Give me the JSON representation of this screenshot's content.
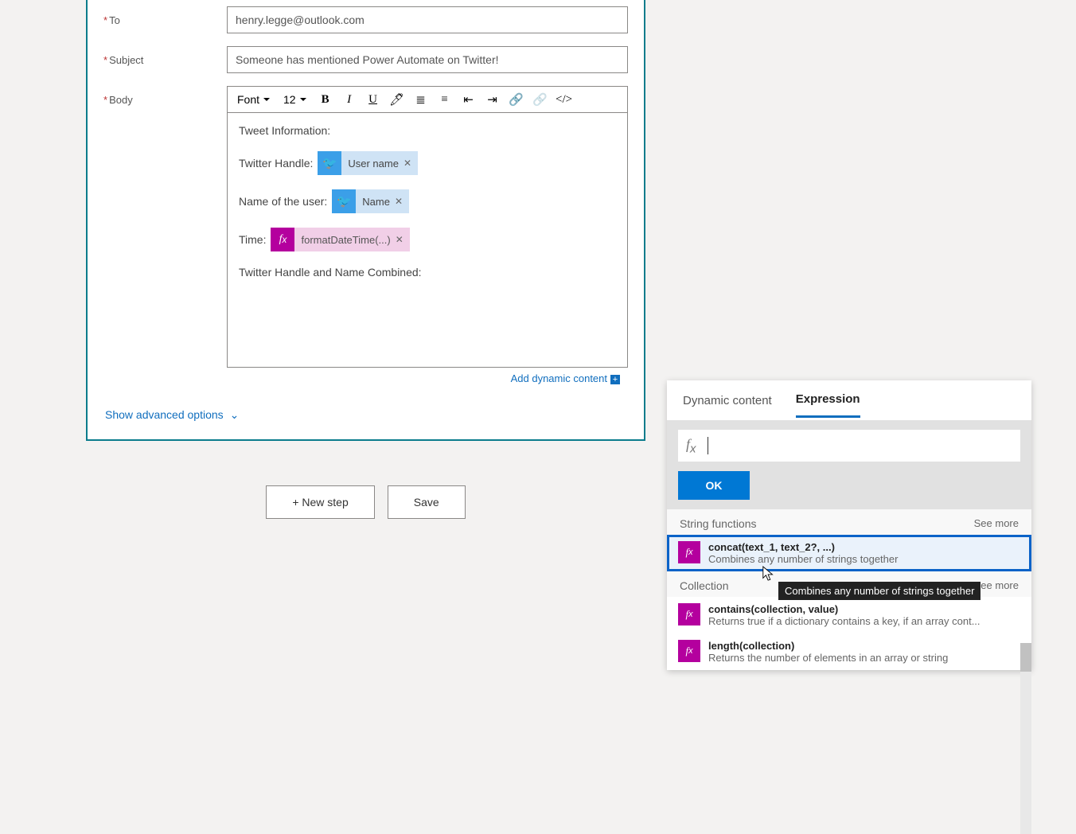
{
  "form": {
    "to_label": "To",
    "to_value": "henry.legge@outlook.com",
    "subject_label": "Subject",
    "subject_value": "Someone has mentioned Power Automate on Twitter!",
    "body_label": "Body",
    "font_label": "Font",
    "font_size": "12",
    "body_lines": {
      "l1": "Tweet Information:",
      "l2": "Twitter Handle:",
      "l3": "Name of the user:",
      "l4": "Time:",
      "l5": "Twitter Handle and Name Combined:"
    },
    "tokens": {
      "username": "User name",
      "name": "Name",
      "fdt": "formatDateTime(...)"
    },
    "add_dynamic": "Add dynamic content",
    "advanced": "Show advanced options"
  },
  "actions": {
    "new_step": "+ New step",
    "save": "Save"
  },
  "panel": {
    "tab_dynamic": "Dynamic content",
    "tab_expression": "Expression",
    "ok": "OK",
    "sections": [
      {
        "title": "String functions",
        "see": "See more"
      },
      {
        "title": "Collection",
        "see": "See more"
      }
    ],
    "functions": {
      "concat_name": "concat(text_1, text_2?, ...)",
      "concat_desc": "Combines any number of strings together",
      "contains_name": "contains(collection, value)",
      "contains_desc": "Returns true if a dictionary contains a key, if an array cont...",
      "length_name": "length(collection)",
      "length_desc": "Returns the number of elements in an array or string"
    },
    "tooltip": "Combines any number of strings together"
  }
}
